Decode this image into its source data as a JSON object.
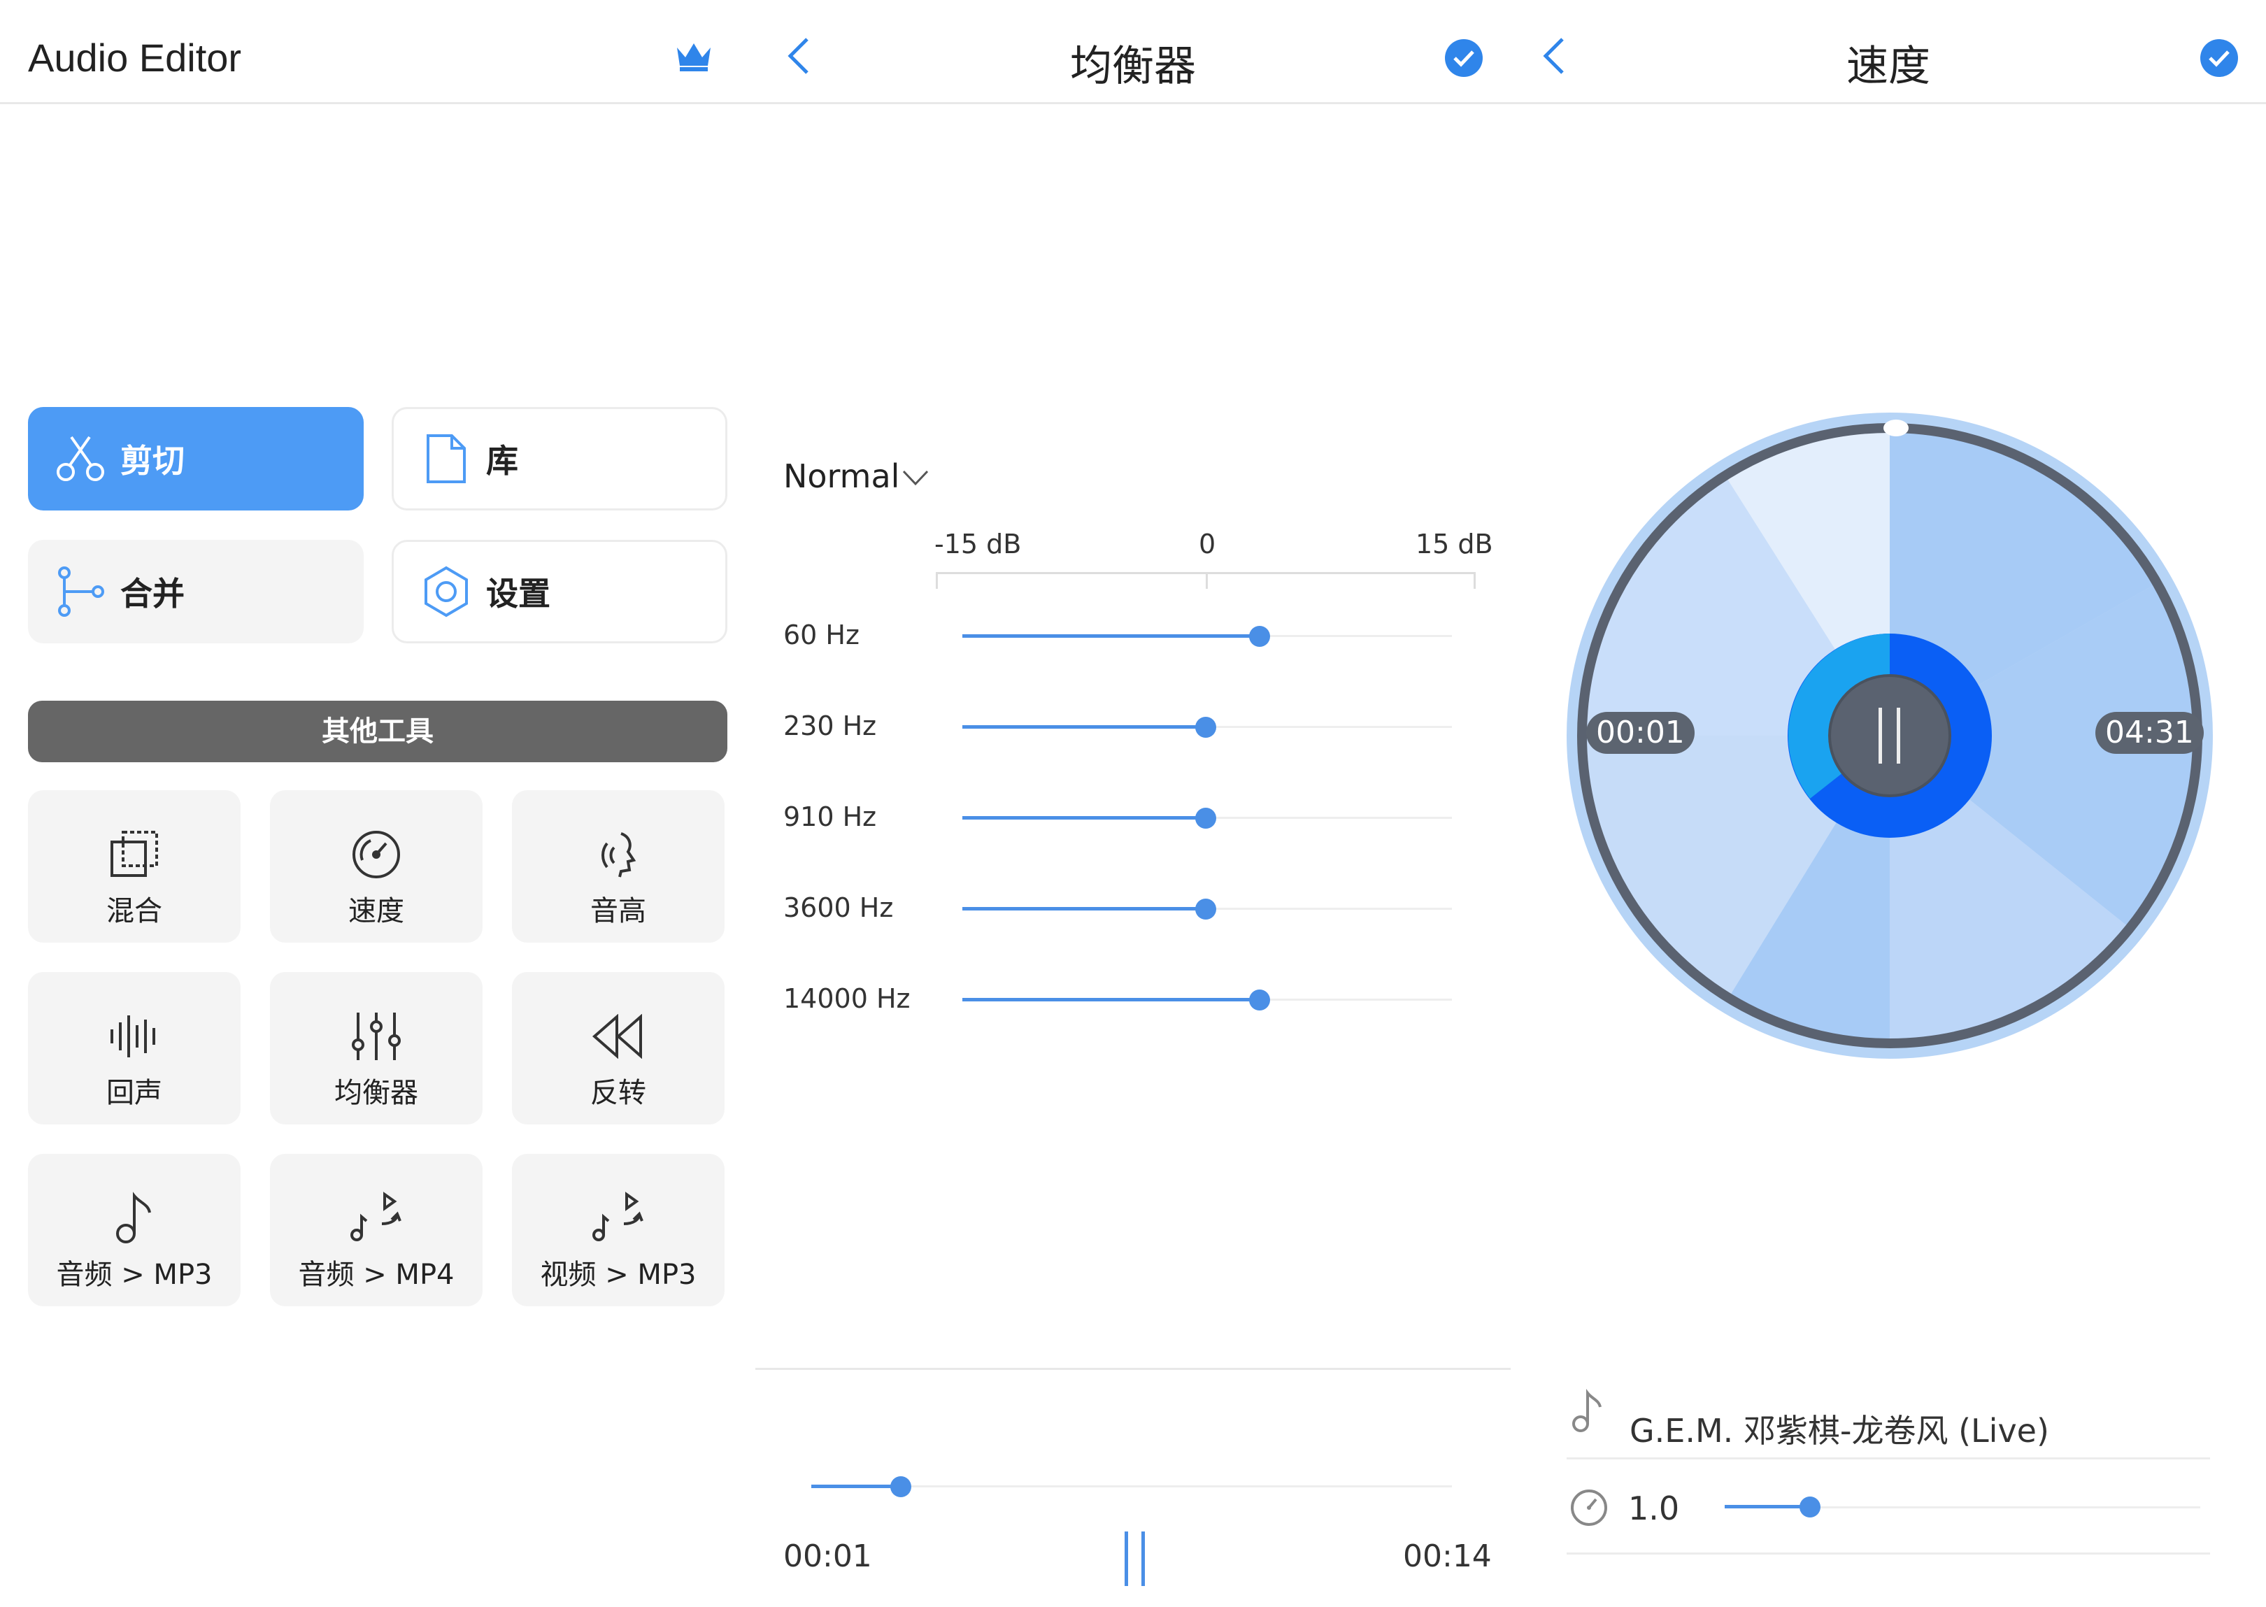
{
  "home": {
    "app_title": "Audio Editor",
    "main_buttons": [
      {
        "label": "剪切",
        "icon": "scissors-icon"
      },
      {
        "label": "库",
        "icon": "file-icon"
      },
      {
        "label": "合并",
        "icon": "merge-icon"
      },
      {
        "label": "设置",
        "icon": "settings-icon"
      }
    ],
    "other_tools_title": "其他工具",
    "tools": [
      {
        "label": "混合",
        "icon": "mix-icon"
      },
      {
        "label": "速度",
        "icon": "speedometer-icon"
      },
      {
        "label": "音高",
        "icon": "pitch-icon"
      },
      {
        "label": "回声",
        "icon": "echo-icon"
      },
      {
        "label": "均衡器",
        "icon": "equalizer-icon"
      },
      {
        "label": "反转",
        "icon": "reverse-icon"
      },
      {
        "label": "音频 > MP3",
        "icon": "music-note-icon"
      },
      {
        "label": "音频 > MP4",
        "icon": "music-to-video-icon"
      },
      {
        "label": "视频 > MP3",
        "icon": "video-to-music-icon"
      }
    ]
  },
  "equalizer": {
    "title": "均衡器",
    "preset": "Normal",
    "scale": {
      "min": "-15 dB",
      "mid": "0",
      "max": "15 dB"
    },
    "bands": [
      {
        "label": "60 Hz",
        "value": 3
      },
      {
        "label": "230 Hz",
        "value": 0
      },
      {
        "label": "910 Hz",
        "value": 0
      },
      {
        "label": "3600 Hz",
        "value": 0
      },
      {
        "label": "14000 Hz",
        "value": 3
      }
    ],
    "progress": 0.14,
    "time_current": "00:01",
    "time_total": "00:14"
  },
  "speed": {
    "title": "速度",
    "time_current": "00:01",
    "time_total": "04:31",
    "song_title": "G.E.M. 邓紫棋-龙卷风 (Live)",
    "speed_value": "1.0",
    "speed_fraction": 0.18
  },
  "colors": {
    "accent": "#4d9bf5",
    "slider": "#4a8fe6",
    "check": "#2f85ea",
    "dark_bar": "#666666"
  }
}
